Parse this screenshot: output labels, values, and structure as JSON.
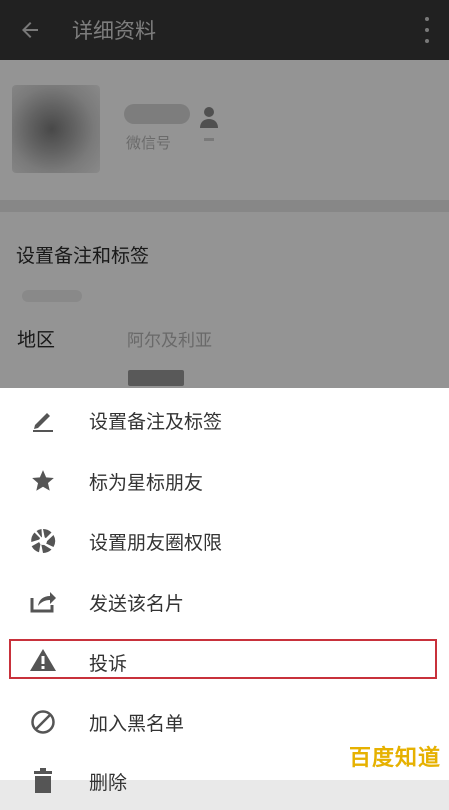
{
  "header": {
    "title": "详细资料",
    "back_icon": "arrow-back-icon",
    "more_icon": "more-vertical-icon"
  },
  "profile": {
    "wechat_id_label": "微信号"
  },
  "details": {
    "remark_label": "设置备注和标签",
    "region_label": "地区",
    "region_value": "阿尔及利亚"
  },
  "menu": {
    "items": [
      {
        "label": "设置备注及标签",
        "icon": "pencil-icon"
      },
      {
        "label": "标为星标朋友",
        "icon": "star-icon"
      },
      {
        "label": "设置朋友圈权限",
        "icon": "moments-icon"
      },
      {
        "label": "发送该名片",
        "icon": "share-icon"
      },
      {
        "label": "投诉",
        "icon": "warning-icon"
      },
      {
        "label": "加入黑名单",
        "icon": "block-icon"
      },
      {
        "label": "删除",
        "icon": "trash-icon"
      }
    ],
    "highlight_color": "#c8313b"
  },
  "watermark": "百度知道"
}
